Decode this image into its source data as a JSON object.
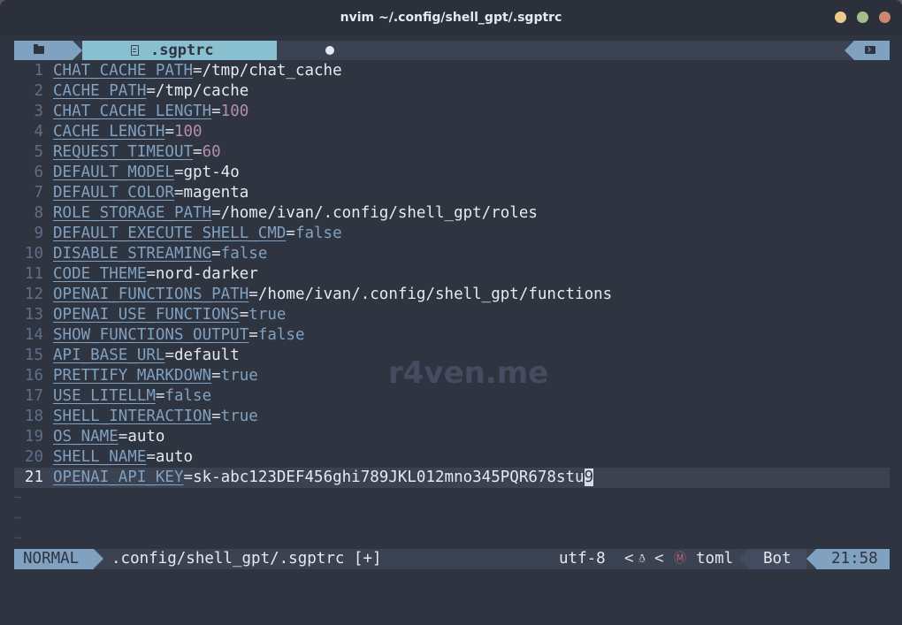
{
  "window": {
    "title": "nvim ~/.config/shell_gpt/.sgptrc",
    "colors": {
      "close": "#d08770",
      "maximize": "#a3be8c",
      "minimize": "#ebcb8b"
    }
  },
  "tabline": {
    "active_tab": ".sgptrc",
    "icons": [
      "folder-icon",
      "file-icon",
      "modified-dot",
      "terminal-icon"
    ]
  },
  "editor": {
    "lines": [
      {
        "num": "1",
        "key": "CHAT_CACHE_PATH",
        "eq": "=",
        "val": "/tmp/chat_cache",
        "kind": "str"
      },
      {
        "num": "2",
        "key": "CACHE_PATH",
        "eq": "=",
        "val": "/tmp/cache",
        "kind": "str"
      },
      {
        "num": "3",
        "key": "CHAT_CACHE_LENGTH",
        "eq": "=",
        "val": "100",
        "kind": "num"
      },
      {
        "num": "4",
        "key": "CACHE_LENGTH",
        "eq": "=",
        "val": "100",
        "kind": "num"
      },
      {
        "num": "5",
        "key": "REQUEST_TIMEOUT",
        "eq": "=",
        "val": "60",
        "kind": "num"
      },
      {
        "num": "6",
        "key": "DEFAULT_MODEL",
        "eq": "=",
        "val": "gpt-4o",
        "kind": "str"
      },
      {
        "num": "7",
        "key": "DEFAULT_COLOR",
        "eq": "=",
        "val": "magenta",
        "kind": "str"
      },
      {
        "num": "8",
        "key": "ROLE_STORAGE_PATH",
        "eq": "=",
        "val": "/home/ivan/.config/shell_gpt/roles",
        "kind": "str"
      },
      {
        "num": "9",
        "key": "DEFAULT_EXECUTE_SHELL_CMD",
        "eq": "=",
        "val": "false",
        "kind": "kw"
      },
      {
        "num": "10",
        "key": "DISABLE_STREAMING",
        "eq": "=",
        "val": "false",
        "kind": "kw"
      },
      {
        "num": "11",
        "key": "CODE_THEME",
        "eq": "=",
        "val": "nord-darker",
        "kind": "str"
      },
      {
        "num": "12",
        "key": "OPENAI_FUNCTIONS_PATH",
        "eq": "=",
        "val": "/home/ivan/.config/shell_gpt/functions",
        "kind": "str"
      },
      {
        "num": "13",
        "key": "OPENAI_USE_FUNCTIONS",
        "eq": "=",
        "val": "true",
        "kind": "kw"
      },
      {
        "num": "14",
        "key": "SHOW_FUNCTIONS_OUTPUT",
        "eq": "=",
        "val": "false",
        "kind": "kw"
      },
      {
        "num": "15",
        "key": "API_BASE_URL",
        "eq": "=",
        "val": "default",
        "kind": "str"
      },
      {
        "num": "16",
        "key": "PRETTIFY_MARKDOWN",
        "eq": "=",
        "val": "true",
        "kind": "kw"
      },
      {
        "num": "17",
        "key": "USE_LITELLM",
        "eq": "=",
        "val": "false",
        "kind": "kw"
      },
      {
        "num": "18",
        "key": "SHELL_INTERACTION",
        "eq": "=",
        "val": "true",
        "kind": "kw"
      },
      {
        "num": "19",
        "key": "OS_NAME",
        "eq": "=",
        "val": "auto",
        "kind": "str"
      },
      {
        "num": "20",
        "key": "SHELL_NAME",
        "eq": "=",
        "val": "auto",
        "kind": "str"
      },
      {
        "num": "21",
        "key": "OPENAI_API_KEY",
        "eq": "=",
        "val": "sk-abc123DEF456ghi789JKL012mno345PQR678stu",
        "cursor_char": "9",
        "kind": "str",
        "current": true
      }
    ],
    "tilde": "~",
    "watermark": "r4ven.me"
  },
  "statusline": {
    "mode": "NORMAL",
    "path": ".config/shell_gpt/.sgptrc [+]",
    "encoding": "utf-8",
    "separator": "<",
    "os_icon": "linux-icon",
    "filetype_icon": "toml-icon",
    "filetype": "toml",
    "position": "Bot",
    "clock": "21:58"
  }
}
